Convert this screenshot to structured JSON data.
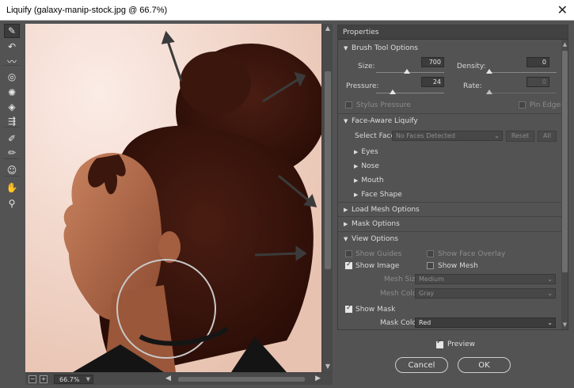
{
  "window": {
    "title": "Liquify (galaxy-manip-stock.jpg @ 66.7%)"
  },
  "tools": [
    {
      "icon": "forward-warp-tool-icon",
      "glyph": "✎",
      "active": true
    },
    {
      "icon": "reconstruct-tool-icon",
      "glyph": "↶"
    },
    {
      "icon": "smooth-tool-icon",
      "glyph": "〰"
    },
    {
      "icon": "twirl-tool-icon",
      "glyph": "◎"
    },
    {
      "icon": "pucker-tool-icon",
      "glyph": "✺"
    },
    {
      "icon": "bloat-tool-icon",
      "glyph": "◈"
    },
    {
      "icon": "push-left-tool-icon",
      "glyph": "⇶"
    },
    {
      "icon": "freeze-mask-tool-icon",
      "glyph": "✐"
    },
    {
      "icon": "thaw-mask-tool-icon",
      "glyph": "✏"
    },
    {
      "icon": "face-tool-icon",
      "glyph": "☺"
    },
    {
      "icon": "hand-tool-icon",
      "glyph": "✋"
    },
    {
      "icon": "zoom-tool-icon",
      "glyph": "⚲"
    }
  ],
  "zoom": {
    "minus": "−",
    "plus": "+",
    "value": "66.7%"
  },
  "properties": {
    "header": "Properties",
    "brush": {
      "title": "Brush Tool Options",
      "size_label": "Size:",
      "size_value": "700",
      "density_label": "Density:",
      "density_value": "0",
      "pressure_label": "Pressure:",
      "pressure_value": "24",
      "rate_label": "Rate:",
      "rate_value": "0",
      "stylus_label": "Stylus Pressure",
      "pin_label": "Pin Edges"
    },
    "face": {
      "title": "Face-Aware Liquify",
      "select_label": "Select Face:",
      "select_value": "No Faces Detected",
      "reset": "Reset",
      "all": "All",
      "items": [
        "Eyes",
        "Nose",
        "Mouth",
        "Face Shape"
      ]
    },
    "load_mesh": "Load Mesh Options",
    "mask": "Mask Options",
    "view": {
      "title": "View Options",
      "show_guides": "Show Guides",
      "show_face_overlay": "Show Face Overlay",
      "show_image": "Show Image",
      "show_mesh": "Show Mesh",
      "mesh_size_label": "Mesh Size:",
      "mesh_size_value": "Medium",
      "mesh_color_label": "Mesh Color:",
      "mesh_color_value": "Gray",
      "show_mask": "Show Mask",
      "mask_color_label": "Mask Color:",
      "mask_color_value": "Red"
    }
  },
  "footer": {
    "preview": "Preview",
    "cancel": "Cancel",
    "ok": "OK"
  }
}
